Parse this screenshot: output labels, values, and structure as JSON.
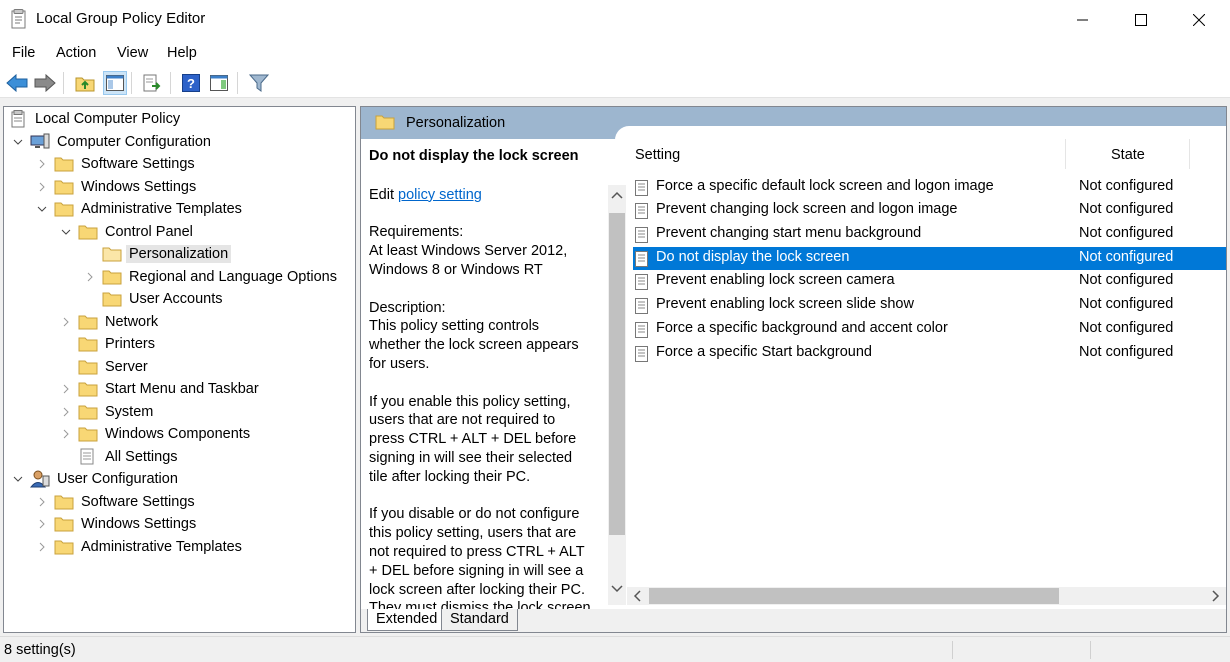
{
  "window": {
    "title": "Local Group Policy Editor"
  },
  "menu": [
    "File",
    "Action",
    "View",
    "Help"
  ],
  "toolbar": {
    "buttons": [
      "back-icon",
      "forward-icon",
      "up-folder-icon",
      "show-hide-tree-icon",
      "export-list-icon",
      "help-icon",
      "show-hide-action-pane-icon",
      "filter-icon"
    ]
  },
  "tree": {
    "root": "Local Computer Policy",
    "computer_config": "Computer Configuration",
    "cc_software": "Software Settings",
    "cc_windows": "Windows Settings",
    "cc_admin": "Administrative Templates",
    "control_panel": "Control Panel",
    "personalization": "Personalization",
    "regional": "Regional and Language Options",
    "user_accounts": "User Accounts",
    "network": "Network",
    "printers": "Printers",
    "server": "Server",
    "start_menu": "Start Menu and Taskbar",
    "system": "System",
    "windows_components": "Windows Components",
    "all_settings": "All Settings",
    "user_config": "User Configuration",
    "uc_software": "Software Settings",
    "uc_windows": "Windows Settings",
    "uc_admin": "Administrative Templates"
  },
  "right": {
    "header_title": "Personalization",
    "desc": {
      "title": "Do not display the lock screen",
      "edit_prefix": "Edit ",
      "edit_link": "policy setting ",
      "requirements_label": "Requirements:",
      "requirements_text": "At least Windows Server 2012, Windows 8 or Windows RT",
      "description_label": "Description:",
      "p1": "This policy setting controls whether the lock screen appears for users.",
      "p2": "If you enable this policy setting, users that are not required to press CTRL + ALT + DEL before signing in will see their selected tile after locking their PC.",
      "p3": "If you disable or do not configure this policy setting, users that are not required to press CTRL + ALT + DEL before signing in will see a lock screen after locking their PC. They must dismiss the lock screen"
    },
    "columns": {
      "setting": "Setting",
      "state": "State"
    },
    "settings": [
      {
        "name": "Force a specific default lock screen and logon image",
        "state": "Not configured"
      },
      {
        "name": "Prevent changing lock screen and logon image",
        "state": "Not configured"
      },
      {
        "name": "Prevent changing start menu background",
        "state": "Not configured"
      },
      {
        "name": "Do not display the lock screen",
        "state": "Not configured"
      },
      {
        "name": "Prevent enabling lock screen camera",
        "state": "Not configured"
      },
      {
        "name": "Prevent enabling lock screen slide show",
        "state": "Not configured"
      },
      {
        "name": "Force a specific background and accent color",
        "state": "Not configured"
      },
      {
        "name": "Force a specific Start background",
        "state": "Not configured"
      }
    ],
    "tabs": {
      "extended": "Extended",
      "standard": "Standard"
    }
  },
  "status": "8 setting(s)",
  "colors": {
    "selection": "#0078d7",
    "header": "#9db6cf",
    "link": "#0066cc",
    "folder": "#f8d775"
  }
}
